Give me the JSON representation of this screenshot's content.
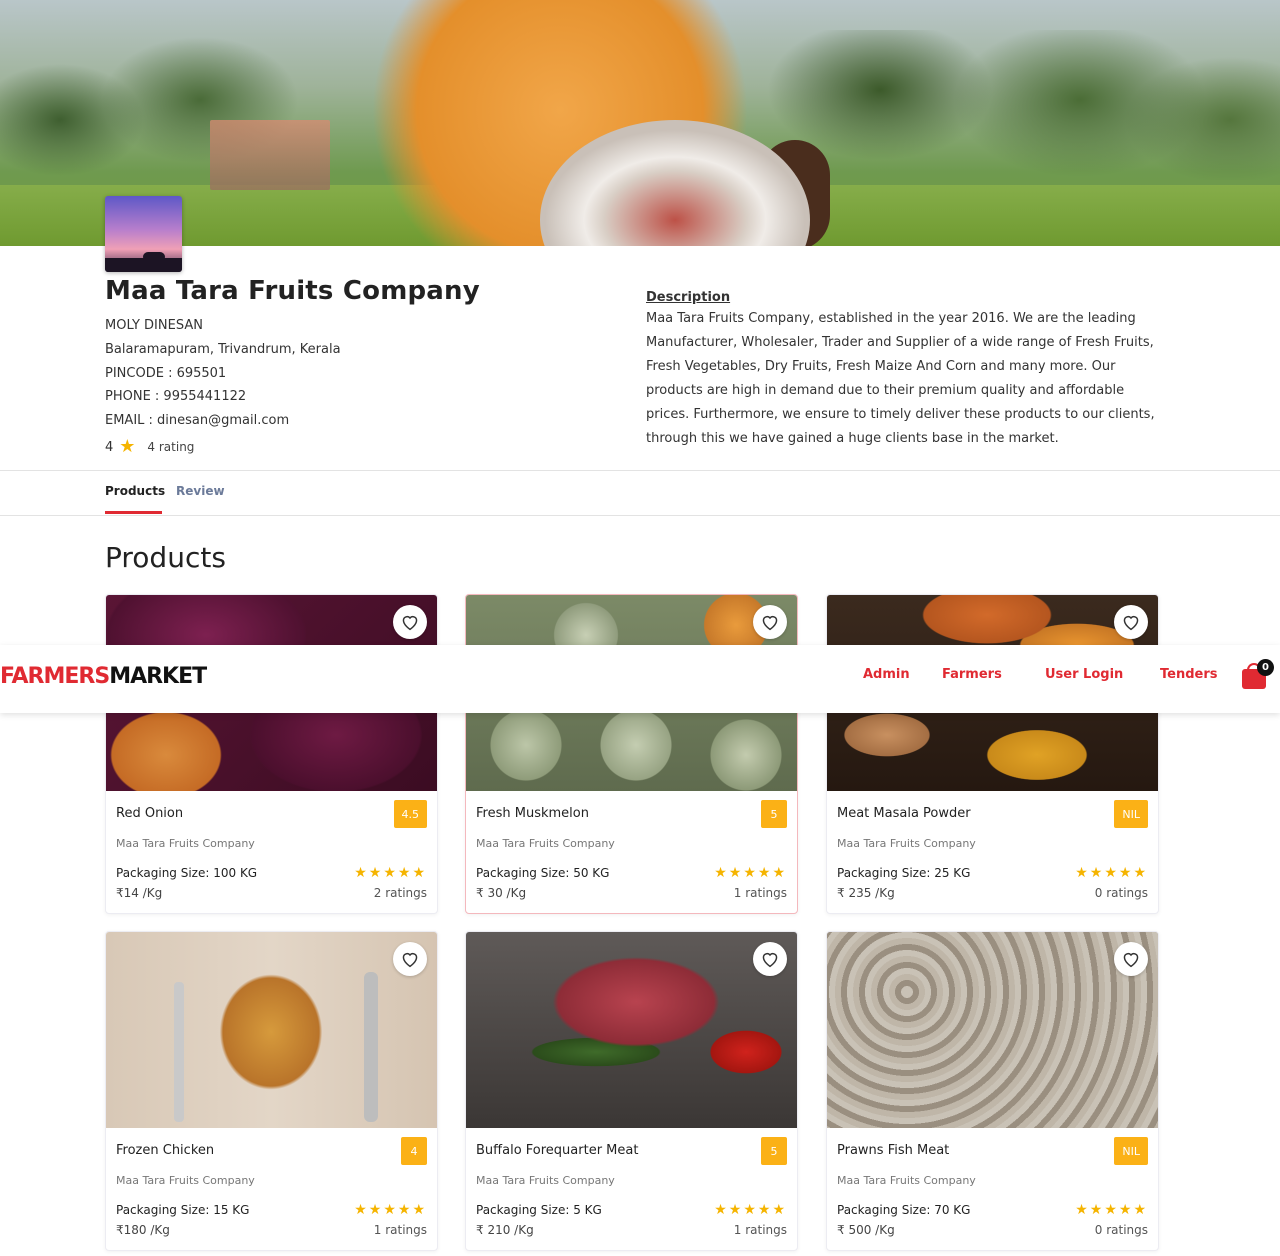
{
  "company": {
    "name": "Maa Tara Fruits Company",
    "owner": "MOLY DINESAN",
    "address": "Balaramapuram, Trivandrum, Kerala",
    "pincode": "PINCODE : 695501",
    "phone": "PHONE : 9955441122",
    "email": "EMAIL : dinesan@gmail.com",
    "rating_value": "4",
    "rating_count": "4 rating",
    "description_title": "Description",
    "description": "Maa Tara Fruits Company, established in the year 2016. We are the leading Manufacturer, Wholesaler, Trader and Supplier of a wide range of Fresh Fruits, Fresh Vegetables, Dry Fruits, Fresh Maize And Corn and many more. Our products are high in demand due to their premium quality and affordable prices. Furthermore, we ensure to timely deliver these products to our clients, through this we have gained a huge clients base in the market."
  },
  "tabs": {
    "products": "Products",
    "review": "Review"
  },
  "section_heading": "Products",
  "products": [
    {
      "name": "Red Onion",
      "badge": "4.5",
      "company": "Maa Tara Fruits Company",
      "packaging": "Packaging Size: 100 KG",
      "price": "₹14 /Kg",
      "stars": "★★★★★",
      "ratings": "2 ratings"
    },
    {
      "name": "Fresh Muskmelon",
      "badge": "5",
      "company": "Maa Tara Fruits Company",
      "packaging": "Packaging Size: 50 KG",
      "price": "₹ 30 /Kg",
      "stars": "★★★★★",
      "ratings": "1 ratings"
    },
    {
      "name": "Meat Masala Powder",
      "badge": "NIL",
      "company": "Maa Tara Fruits Company",
      "packaging": "Packaging Size: 25 KG",
      "price": "₹ 235 /Kg",
      "stars": "★★★★★",
      "ratings": "0 ratings"
    },
    {
      "name": "Frozen Chicken",
      "badge": "4",
      "company": "Maa Tara Fruits Company",
      "packaging": "Packaging Size: 15 KG",
      "price": "₹180 /Kg",
      "stars": "★★★★★",
      "ratings": "1 ratings"
    },
    {
      "name": "Buffalo Forequarter Meat",
      "badge": "5",
      "company": "Maa Tara Fruits Company",
      "packaging": "Packaging Size: 5 KG",
      "price": "₹ 210 /Kg",
      "stars": "★★★★★",
      "ratings": "1 ratings"
    },
    {
      "name": "Prawns Fish Meat",
      "badge": "NIL",
      "company": "Maa Tara Fruits Company",
      "packaging": "Packaging Size: 70 KG",
      "price": "₹ 500 /Kg",
      "stars": "★★★★★",
      "ratings": "0 ratings"
    }
  ],
  "navbar": {
    "logo_part1": "FARMERS",
    "logo_part2": "MARKET",
    "links": [
      "Admin",
      "Farmers",
      "User Login",
      "Tenders"
    ],
    "cart_count": "0"
  },
  "colors": {
    "accent": "#e02a32",
    "badge": "#fbb116",
    "star": "#f5b400"
  }
}
